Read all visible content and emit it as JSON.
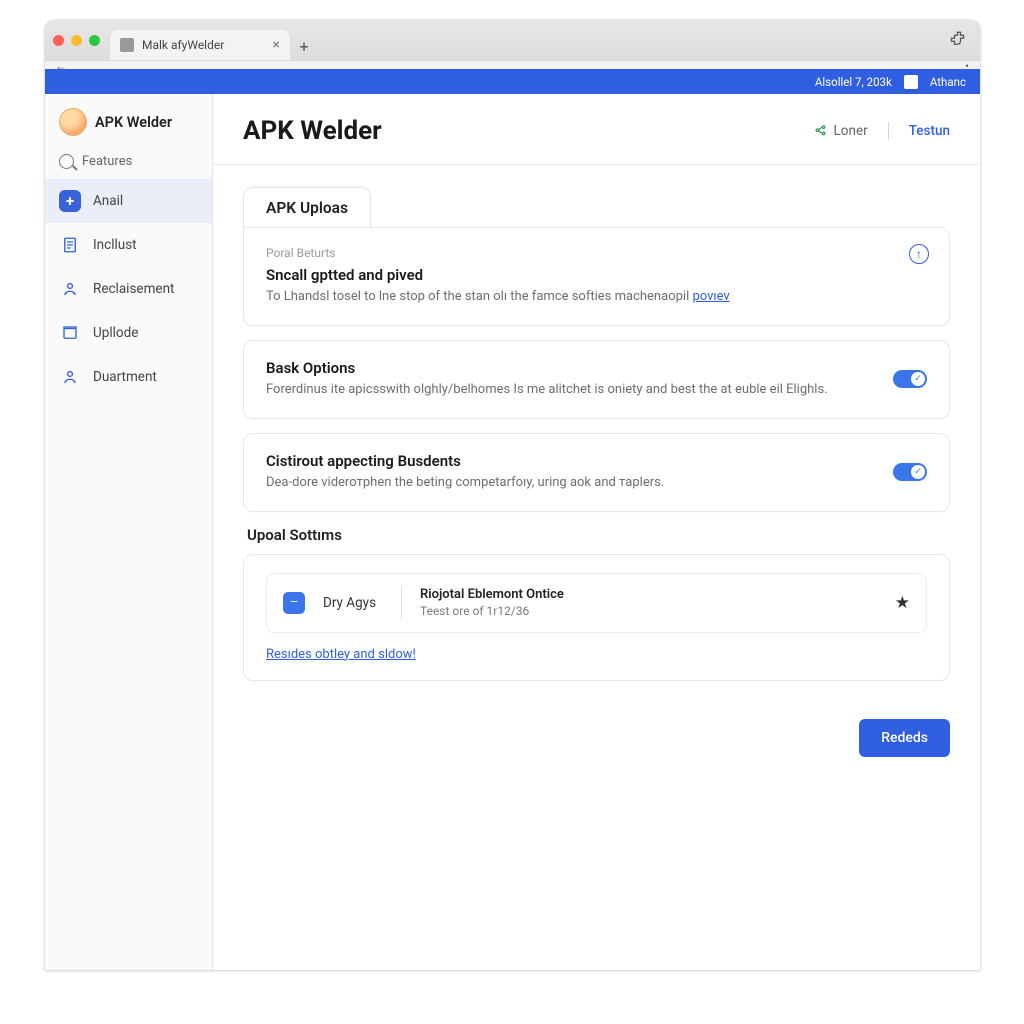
{
  "browser": {
    "tab_title": "Malk afyWelder",
    "extension_name": "puzzle-icon"
  },
  "bluebar": {
    "date": "Alsollel 7, 203k",
    "user": "Athanc"
  },
  "brand": {
    "name": "APK Welder"
  },
  "search": {
    "label": "Features"
  },
  "sidebar": {
    "items": [
      {
        "label": "Anail"
      },
      {
        "label": "Incllust"
      },
      {
        "label": "Reclaisement"
      },
      {
        "label": "Upllode"
      },
      {
        "label": "Duartment"
      }
    ]
  },
  "page": {
    "title": "APK Welder",
    "share": "Loner",
    "testun": "Testun"
  },
  "tabs": {
    "uploas": "APK Uploas"
  },
  "card1": {
    "pretitle": "Poral Beturts",
    "title": "Sncall gptted and pived",
    "desc": "To Lhandsl tosel to lne stop of the stan olı the famce softies machenaopil ",
    "link": "povıev"
  },
  "card2": {
    "title": "Bask Options",
    "desc": "Forerdinus ite apicsswith olghly/belhomes Is me alitchet is oniety and best the at euble eil Elighls."
  },
  "card3": {
    "title": "Cistirout appecting Busdents",
    "desc": "Dea-dore videroтphen the beting competarfoıy, uring aok and тaplers."
  },
  "section": {
    "title": "Upoal Sottıms",
    "row_label": "Dry Agys",
    "row_title": "Riojotal Eblemont Ontice",
    "row_sub": "Teest ore of 1r12/36",
    "bottom_link": "Resıdes obtley and sldow!"
  },
  "footer": {
    "primary": "Rededs"
  }
}
